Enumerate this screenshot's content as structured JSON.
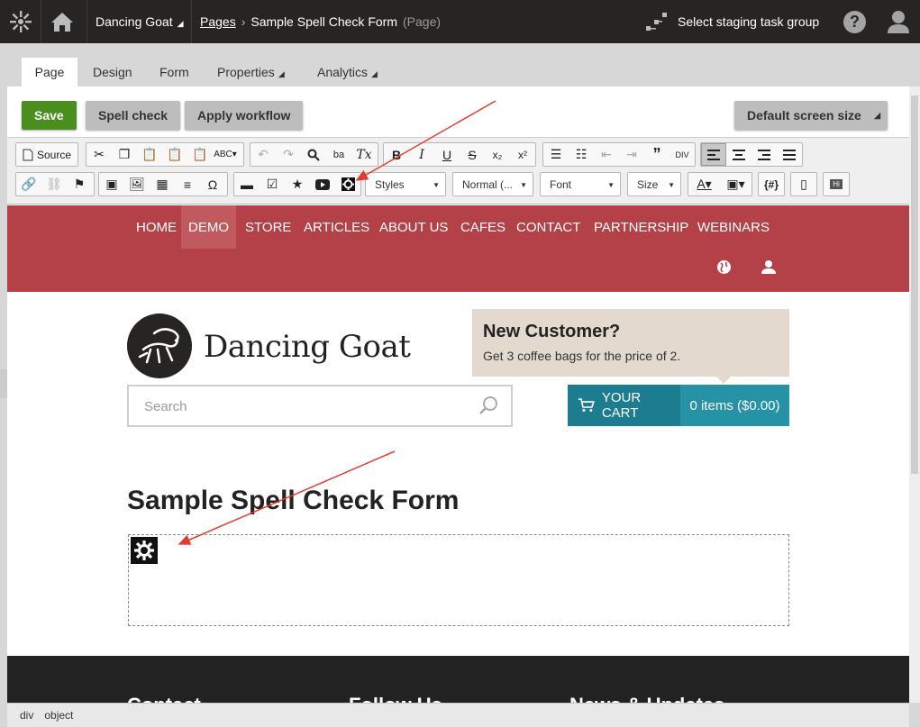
{
  "topbar": {
    "site_name": "Dancing Goat",
    "breadcrumb_link": "Pages",
    "breadcrumb_current": "Sample Spell Check Form",
    "breadcrumb_type": "(Page)",
    "staging": "Select staging task group",
    "help": "?"
  },
  "tabs": [
    {
      "label": "Page"
    },
    {
      "label": "Design"
    },
    {
      "label": "Form"
    },
    {
      "label": "Properties"
    },
    {
      "label": "Analytics"
    }
  ],
  "actions": {
    "save": "Save",
    "spell_check": "Spell check",
    "apply_workflow": "Apply workflow",
    "screen_size": "Default screen size"
  },
  "toolbar": {
    "source": "Source",
    "styles": "Styles",
    "format": "Normal (...",
    "font": "Font",
    "size": "Size",
    "template_vars": "{#}",
    "hi": "Hi"
  },
  "site": {
    "nav": [
      "HOME",
      "DEMO",
      "STORE",
      "ARTICLES",
      "ABOUT US",
      "CAFES",
      "CONTACT",
      "PARTNERSHIP",
      "WEBINARS"
    ],
    "brand": "Dancing Goat",
    "promo_title": "New Customer?",
    "promo_text": "Get 3 coffee bags for the price of 2.",
    "search_placeholder": "Search",
    "cart_label": "YOUR CART",
    "cart_items": "0 items ($0.00)",
    "heading": "Sample Spell Check Form",
    "footer": [
      "Contact",
      "Follow Us",
      "News & Updates"
    ]
  },
  "statusbar": [
    "div",
    "object"
  ],
  "colors": {
    "nav": "#b44147",
    "cart": "#1c7d90",
    "save": "#4a8f1e",
    "topbar": "#262524"
  }
}
